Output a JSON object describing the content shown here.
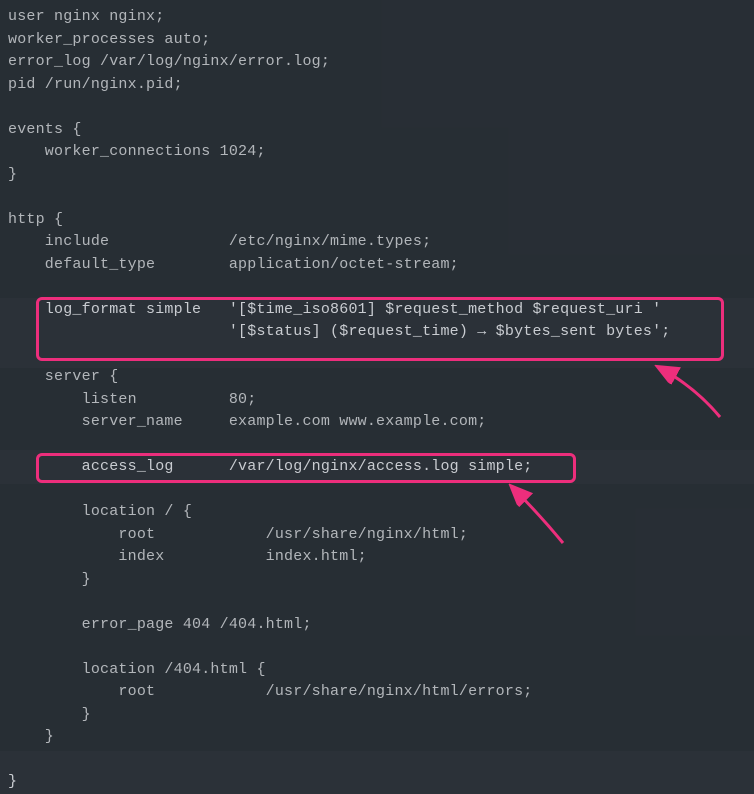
{
  "code": {
    "l1": "user nginx nginx;",
    "l2": "worker_processes auto;",
    "l3": "error_log /var/log/nginx/error.log;",
    "l4": "pid /run/nginx.pid;",
    "l5": "",
    "l6": "events {",
    "l7": "    worker_connections 1024;",
    "l8": "}",
    "l9": "",
    "l10": "http {",
    "l11": "    include             /etc/nginx/mime.types;",
    "l12": "    default_type        application/octet-stream;",
    "l13": "",
    "l14": "    log_format simple   '[$time_iso8601] $request_method $request_uri '",
    "l15": "                        '[$status] ($request_time) → $bytes_sent bytes';",
    "l16": "",
    "l17": "    server {",
    "l18": "        listen          80;",
    "l19": "        server_name     example.com www.example.com;",
    "l20": "",
    "l21": "        access_log      /var/log/nginx/access.log simple;",
    "l22": "",
    "l23": "        location / {",
    "l24": "            root            /usr/share/nginx/html;",
    "l25": "            index           index.html;",
    "l26": "        }",
    "l27": "",
    "l28": "        error_page 404 /404.html;",
    "l29": "",
    "l30": "        location /404.html {",
    "l31": "            root            /usr/share/nginx/html/errors;",
    "l32": "        }",
    "l33": "    }",
    "l34": "",
    "l35": "}"
  },
  "highlight": {
    "box1_desc": "log_format simple directive",
    "box2_desc": "access_log directive with simple format"
  },
  "colors": {
    "bg": "#2b3138",
    "fg": "#c9ccd1",
    "accent": "#ed2e7c"
  }
}
